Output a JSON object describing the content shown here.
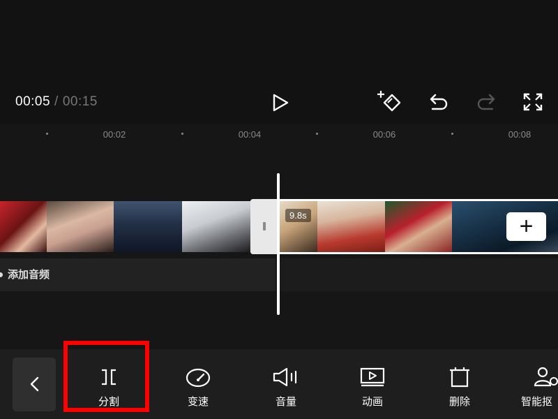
{
  "player": {
    "current_time": "00:05",
    "separator": "/",
    "total_time": "00:15"
  },
  "controls": [
    "play-icon",
    "keyframe-add-icon",
    "undo-icon",
    "redo-icon",
    "fullscreen-icon"
  ],
  "ruler": {
    "ticks": [
      "00:02",
      "00:04",
      "00:06",
      "00:08"
    ]
  },
  "timeline": {
    "clip_duration": "9.8s",
    "add_clip_label": "+",
    "audio_track_label": "添加音频"
  },
  "toolbar": {
    "back_icon": "chevron-left-icon",
    "items": [
      {
        "label": "分割",
        "icon": "split-icon"
      },
      {
        "label": "变速",
        "icon": "speed-icon"
      },
      {
        "label": "音量",
        "icon": "volume-icon"
      },
      {
        "label": "动画",
        "icon": "animation-icon"
      },
      {
        "label": "删除",
        "icon": "delete-icon"
      },
      {
        "label": "智能抠",
        "icon": "smart-cutout-icon"
      }
    ],
    "highlighted_item": "分割"
  },
  "colors": {
    "highlight": "#ff0000",
    "background": "#161616",
    "toolbar": "#1e1e1e"
  }
}
